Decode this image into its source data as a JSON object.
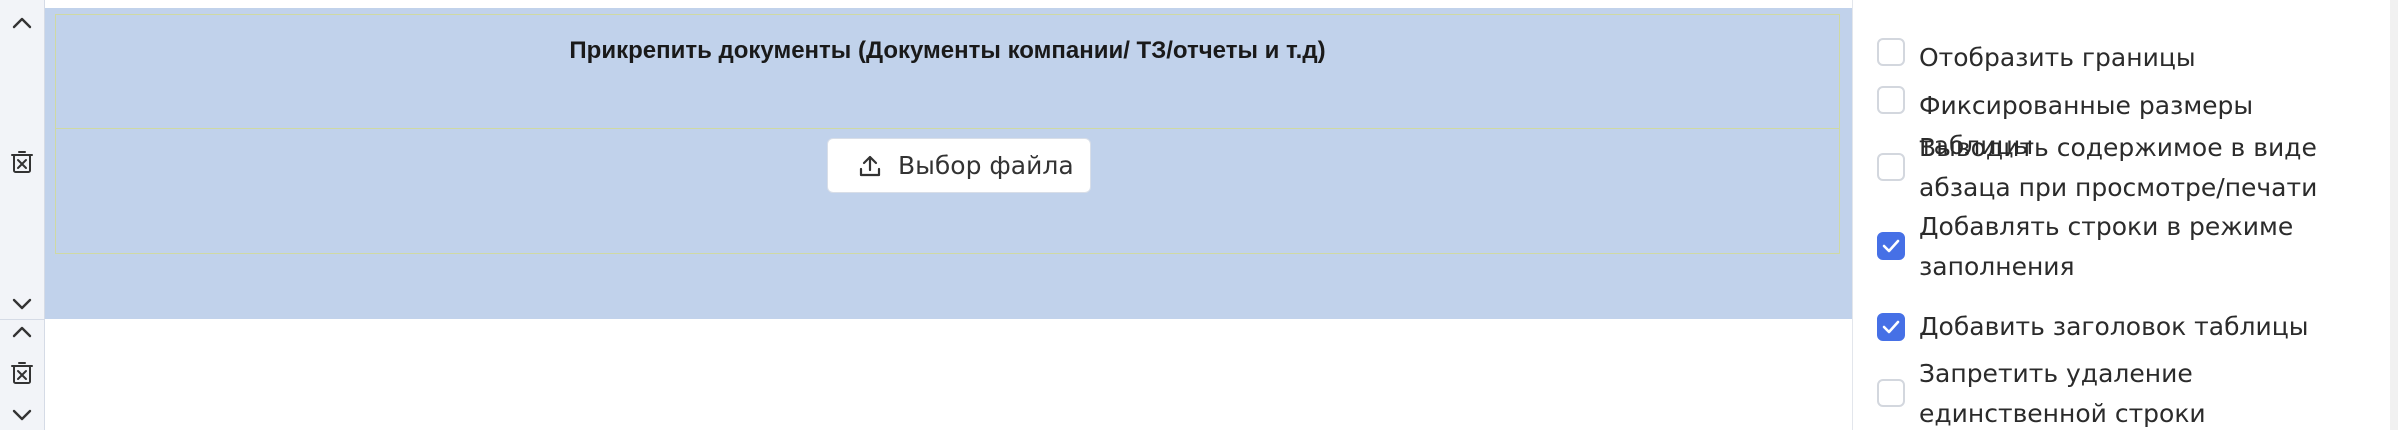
{
  "gutter": {
    "row1": {
      "up_icon": "chevron-up-icon",
      "delete_icon": "delete-row-icon",
      "down_icon": "chevron-down-icon"
    },
    "row2": {
      "up_icon": "chevron-up-icon",
      "delete_icon": "delete-row-icon",
      "down_icon": "chevron-down-icon"
    }
  },
  "table": {
    "header_text": "Прикрепить документы (Документы компании/ ТЗ/отчеты и т.д)",
    "file_button": {
      "label": "Выбор файла",
      "icon": "upload-icon"
    }
  },
  "settings": {
    "options": [
      {
        "label": "Отобразить границы",
        "checked": false
      },
      {
        "label": "Фиксированные размеры таблицы",
        "checked": false
      },
      {
        "label": "Выводить содержимое в виде абзаца при просмотре/печати",
        "checked": false
      },
      {
        "label": "Добавлять строки в режиме заполнения",
        "checked": true
      },
      {
        "label": "Добавить заголовок таблицы",
        "checked": true
      },
      {
        "label": "Запретить удаление единственной строки",
        "checked": false
      }
    ]
  },
  "colors": {
    "table_bg": "#c1d2eb",
    "checkbox_checked": "#4670e6"
  }
}
